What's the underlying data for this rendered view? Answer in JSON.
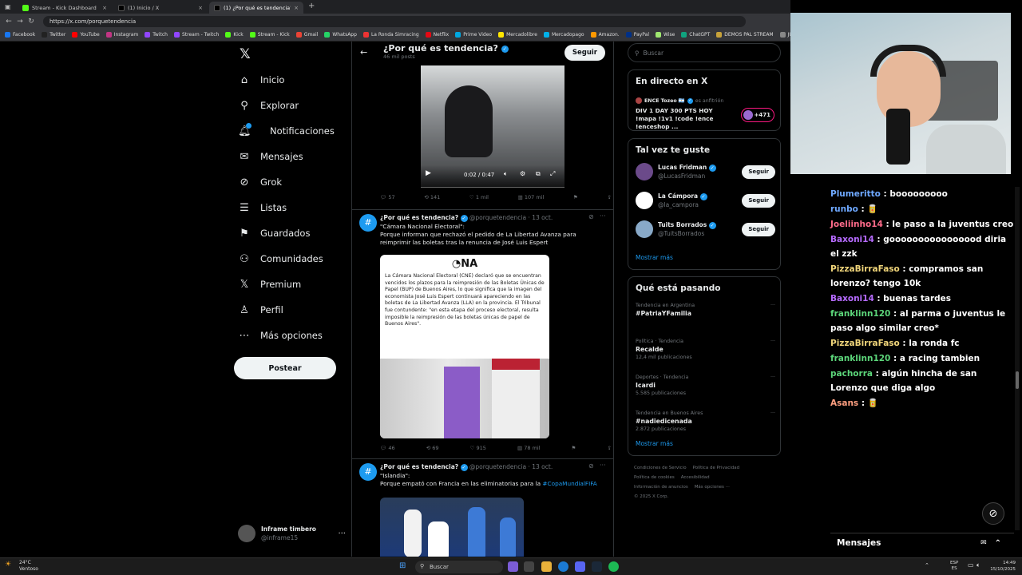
{
  "browser": {
    "tabs": [
      {
        "title": "Stream - Kick Dashboard",
        "color": "#53fc18"
      },
      {
        "title": "(1) Inicio / X",
        "color": "#000000"
      },
      {
        "title": "(1) ¿Por qué es tendencia? (@po...",
        "color": "#000000"
      }
    ],
    "url": "https://x.com/porquetendencia",
    "bookmarks": [
      "Facebook",
      "Twitter",
      "YouTube",
      "Instagram",
      "Twitch",
      "Stream - Twitch",
      "Kick",
      "Stream - Kick",
      "Gmail",
      "WhatsApp",
      "La Ronda Simracing",
      "Netflix",
      "Prime Video",
      "Mercadolibre",
      "Mercadopago",
      "Amazon.",
      "PayPal",
      "Wise",
      "ChatGPT",
      "DEMOS PAL STREAM",
      "JUAN TUR"
    ]
  },
  "xnav": {
    "items": [
      {
        "label": "Inicio",
        "icon": "home-icon",
        "glyph": "⌂"
      },
      {
        "label": "Explorar",
        "icon": "search-icon",
        "glyph": "⚲"
      },
      {
        "label": "Notificaciones",
        "icon": "bell-icon",
        "glyph": "🔔︎"
      },
      {
        "label": "Mensajes",
        "icon": "mail-icon",
        "glyph": "✉"
      },
      {
        "label": "Grok",
        "icon": "grok-icon",
        "glyph": "⊘"
      },
      {
        "label": "Listas",
        "icon": "list-icon",
        "glyph": "☰"
      },
      {
        "label": "Guardados",
        "icon": "bookmark-icon",
        "glyph": "⚑"
      },
      {
        "label": "Comunidades",
        "icon": "people-icon",
        "glyph": "⚇"
      },
      {
        "label": "Premium",
        "icon": "x-logo-icon",
        "glyph": "𝕏"
      },
      {
        "label": "Perfil",
        "icon": "user-icon",
        "glyph": "♙"
      },
      {
        "label": "Más opciones",
        "icon": "more-icon",
        "glyph": "⋯"
      }
    ],
    "post_label": "Postear",
    "profile_name": "Inframe timbero",
    "profile_handle": "@inframe15"
  },
  "feed": {
    "title": "¿Por qué es tendencia?",
    "subtitle": "46 mil posts",
    "follow_label": "Seguir",
    "video_time": "0:02 / 0:47",
    "first_actions": [
      "57",
      "141",
      "1 mil",
      "107 mil"
    ],
    "tweets": [
      {
        "name": "¿Por qué es tendencia?",
        "handle": "@porquetendencia",
        "date": "· 13 oct.",
        "line1": "\"Cámara Nacional Electoral\":",
        "line2": "Porque informan que rechazó el pedido de La Libertad Avanza para reimprimir las boletas tras la renuncia de José Luis Espert",
        "card_logo": "NA",
        "card_text": "La Cámara Nacional Electoral (CNE) declaró que se encuentran vencidos los plazos para la reimpresión de las Boletas Únicas de Papel (BUP) de Buenos Aires, lo que significa que la imagen del economista José Luis Espert continuará apareciendo en las boletas de La Libertad Avanza (LLA) en la provincia. El Tribunal fue contundente: \"en esta etapa del proceso electoral, resulta imposible la reimpresión de las boletas únicas de papel de Buenos Aires\".",
        "actions": [
          "46",
          "69",
          "915",
          "78 mil"
        ]
      },
      {
        "name": "¿Por qué es tendencia?",
        "handle": "@porquetendencia",
        "date": "· 13 oct.",
        "line1": "\"Islandia\":",
        "line2": "Porque empató con Francia en las eliminatorias para la ",
        "hashtag": "#CopaMundialFIFA"
      }
    ]
  },
  "right": {
    "search_placeholder": "Buscar",
    "live_title": "En directo en X",
    "live_host": "ENCE Tozeo 🇦🇷",
    "live_host_suffix": "es anfitrión",
    "live_text": "DIV 1 DAY 300 PTS HOY !mapa !1v1 !code !ence !enceshop ...",
    "live_count": "+471",
    "suggest_title": "Tal vez te guste",
    "suggestions": [
      {
        "name": "Lucas Fridman",
        "handle": "@LucasFridman",
        "color": "#6b4a8a"
      },
      {
        "name": "La Cámpora",
        "handle": "@la_campora",
        "color": "#ffffff"
      },
      {
        "name": "Tuits Borrados",
        "handle": "@TuitsBorrados",
        "color": "#88a9c8"
      }
    ],
    "follow_label": "Seguir",
    "show_more": "Mostrar más",
    "trends_title": "Qué está pasando",
    "trends": [
      {
        "category": "Tendencia en Argentina",
        "name": "#PatriaYFamilia",
        "count": ""
      },
      {
        "category": "Política · Tendencia",
        "name": "Recalde",
        "count": "12,4 mil publicaciones"
      },
      {
        "category": "Deportes · Tendencia",
        "name": "Icardi",
        "count": "5.585 publicaciones"
      },
      {
        "category": "Tendencia en Buenos Aires",
        "name": "#nadiedicenada",
        "count": "2.872 publicaciones"
      }
    ],
    "footer": [
      "Condiciones de Servicio",
      "Política de Privacidad",
      "Política de cookies",
      "Accesibilidad",
      "Información de anuncios",
      "Más opciones ···",
      "© 2025 X Corp."
    ]
  },
  "chat": {
    "messages": [
      {
        "user": "Plumeritto",
        "color": "#6ea8ff",
        "text": ": booooooooo"
      },
      {
        "user": "runbo",
        "color": "#6ea8ff",
        "text": ": 🥫"
      },
      {
        "user": "Joeliinho14",
        "color": "#ff6b8a",
        "text": ": le paso a la juventus creo"
      },
      {
        "user": "Baxoni14",
        "color": "#b66bff",
        "text": ": goooooooooooooood diria el zzk"
      },
      {
        "user": "PizzaBirraFaso",
        "color": "#f0d57a",
        "text": ": compramos san lorenzo? tengo 10k"
      },
      {
        "user": "Baxoni14",
        "color": "#b66bff",
        "text": ": buenas tardes"
      },
      {
        "user": "franklinn120",
        "color": "#5cd67a",
        "text": ": al parma o juventus le paso algo similar creo*"
      },
      {
        "user": "PizzaBirraFaso",
        "color": "#f0d57a",
        "text": ": la ronda fc"
      },
      {
        "user": "franklinn120",
        "color": "#5cd67a",
        "text": ": a racing tambien"
      },
      {
        "user": "pachorra",
        "color": "#5cd67a",
        "text": ": algún hincha de san Lorenzo que diga algo"
      },
      {
        "user": "Asans",
        "color": "#ff9f80",
        "text": ": 🥫"
      }
    ],
    "footer_label": "Mensajes"
  },
  "taskbar": {
    "weather_temp": "24°C",
    "weather_text": "Ventoso",
    "search": "Buscar",
    "lang": "ESP",
    "lang2": "ES",
    "time": "14:49",
    "date": "15/10/2025"
  }
}
